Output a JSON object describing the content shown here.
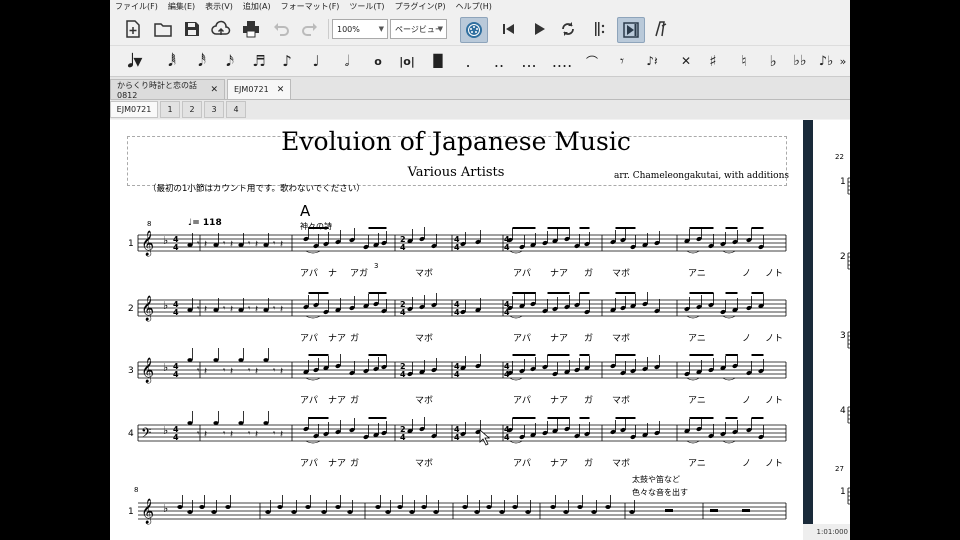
{
  "menu": [
    "ファイル(F)",
    "編集(E)",
    "表示(V)",
    "追加(A)",
    "フォーマット(F)",
    "ツール(T)",
    "プラグイン(P)",
    "ヘルプ(H)"
  ],
  "toolbar": {
    "zoom_value": "100%",
    "view_mode": "ページビュー",
    "icons": [
      "new-file-icon",
      "open-folder-icon",
      "save-icon",
      "cloud-upload-icon",
      "print-icon",
      "undo-icon",
      "redo-icon",
      "midi-input-icon",
      "rewind-icon",
      "play-icon",
      "loop-icon",
      "metronome-icon",
      "playback-panel-icon",
      "mixer-icon"
    ]
  },
  "note_input_toolbar": {
    "icons": [
      "note-input-mode-icon",
      "64th-note-icon",
      "32nd-note-icon",
      "16th-note-icon",
      "eighth-note-icon",
      "quarter-note-icon",
      "half-note-icon",
      "whole-note-icon",
      "breve-icon",
      "longa-icon",
      "dot-icon",
      "double-dot-icon",
      "triple-dot-icon",
      "quadruple-dot-icon",
      "rest-icon",
      "tie-icon",
      "tuplet-icon",
      "toggle-natural-icon",
      "sharp-icon",
      "natural-icon",
      "flat-icon",
      "double-flat-icon",
      "voice-icon",
      "more-icon"
    ]
  },
  "document_tabs": [
    {
      "label": "からくり時計と恋の話0812",
      "close": "✕",
      "active": false
    },
    {
      "label": "EJM0721",
      "close": "✕",
      "active": true
    }
  ],
  "part_tabs": [
    "EJM0721",
    "1",
    "2",
    "3",
    "4"
  ],
  "score": {
    "title": "Evoluion of Japanese Music",
    "subtitle": "Various Artists",
    "arranger": "arr. Chameleongakutai, with additions",
    "note": "（最初の1小節はカウント用です。歌わないでください）",
    "rehearsal_mark": "A",
    "section_text": "神々の詩",
    "tempo": "♩= 118",
    "tuplet_number": "3",
    "measure_number_first": "8",
    "measure_number_second": "8",
    "staff_labels": [
      "1",
      "2",
      "3",
      "4"
    ],
    "second_system_staff_label": "1",
    "lyrics": [
      [
        "アパ",
        "ナ",
        "アガ",
        "マボ",
        "アパ",
        "ナア",
        "ガ",
        "マボ",
        "アニ",
        "ノ",
        "ノト"
      ],
      [
        "アパ",
        "ナア",
        "ガ",
        "マボ",
        "アパ",
        "ナア",
        "ガ",
        "マボ",
        "アニ",
        "ノ",
        "ノト"
      ],
      [
        "アパ",
        "ナア",
        "ガ",
        "マボ",
        "アパ",
        "ナア",
        "ガ",
        "マボ",
        "アニ",
        "ノ",
        "ノト"
      ],
      [
        "アパ",
        "ナア",
        "ガ",
        "マボ",
        "アパ",
        "ナア",
        "ガ",
        "マボ",
        "アニ",
        "ノ",
        "ノト"
      ]
    ],
    "annotation_line1": "太鼓や笛など",
    "annotation_line2": "色々な音を出す"
  },
  "right_pane": {
    "measure_number_top": "22",
    "measure_number_bottom": "27",
    "staff_labels": [
      "1",
      "2",
      "3",
      "4",
      "1"
    ]
  },
  "status": {
    "time": "1:01:000"
  }
}
